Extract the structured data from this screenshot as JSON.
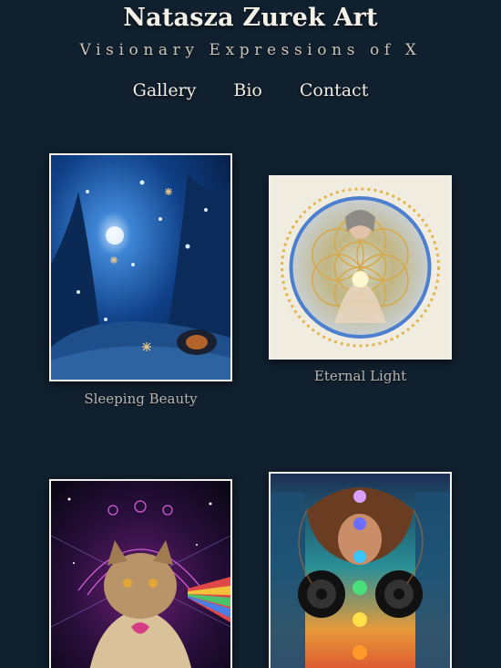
{
  "site": {
    "title": "Natasza Zurek Art",
    "tagline": "Visionary Expressions of X"
  },
  "nav": {
    "items": [
      "Gallery",
      "Bio",
      "Contact"
    ]
  },
  "gallery": {
    "artworks": [
      {
        "caption": "Sleeping Beauty"
      },
      {
        "caption": "Eternal Light"
      },
      {
        "caption": ""
      },
      {
        "caption": ""
      }
    ]
  },
  "colors": {
    "background": "#11202f",
    "frame": "#f2efe8",
    "caption": "#b9b5ad"
  }
}
